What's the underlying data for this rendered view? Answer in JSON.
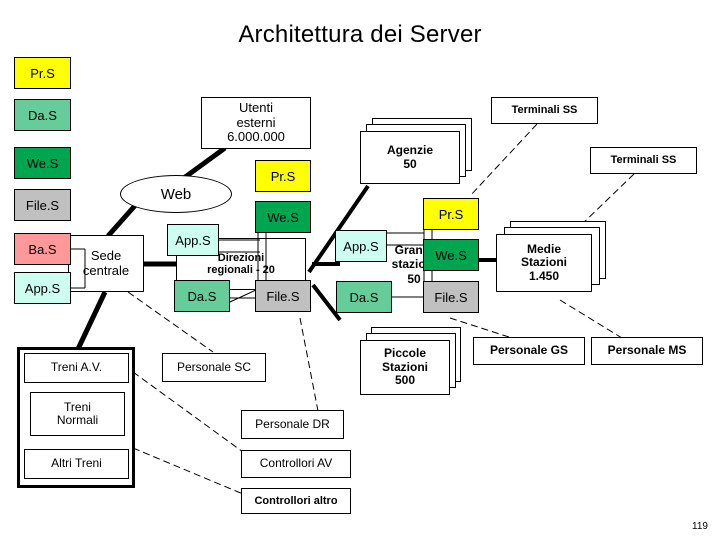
{
  "slide": {
    "title": "Architettura dei Server",
    "page_number": "119",
    "background": "#ffffff"
  },
  "legend": {
    "items": [
      {
        "label": "Pr.S",
        "color": "#ffff00",
        "text_color": "#000000"
      },
      {
        "label": "Da.S",
        "color": "#66cc99",
        "text_color": "#000000"
      },
      {
        "label": "We.S",
        "color": "#00a550",
        "text_color": "#000000"
      },
      {
        "label": "File.S",
        "color": "#c0c0c0",
        "text_color": "#000000"
      },
      {
        "label": "Ba.S",
        "color": "#ff9999",
        "text_color": "#000000"
      },
      {
        "label": "App.S",
        "color": "#ccfff0",
        "text_color": "#000000"
      }
    ]
  },
  "nodes": {
    "utenti_esterni": {
      "line1": "Utenti",
      "line2": "esterni",
      "line3": "6.000.000"
    },
    "web": {
      "label": "Web"
    },
    "sede_centrale": {
      "line1": "Sede",
      "line2": "centrale"
    },
    "agenzie": {
      "line1": "Agenzie",
      "line2": "50"
    },
    "terminali_ss_1": {
      "label": "Terminali SS"
    },
    "terminali_ss_2": {
      "label": "Terminali SS"
    },
    "direzioni_regionali": {
      "line1": "Direzioni",
      "line2": "regionali - 20"
    },
    "grandi_stazioni": {
      "line1": "Grandi",
      "line2": "stazioni",
      "line3": "50"
    },
    "medie_stazioni": {
      "line1": "Medie",
      "line2": "Stazioni",
      "line3": "1.450"
    },
    "piccole_stazioni": {
      "line1": "Piccole",
      "line2": "Stazioni",
      "line3": "500"
    },
    "treni_av": {
      "label": "Treni A.V."
    },
    "treni_normali": {
      "line1": "Treni",
      "line2": "Normali"
    },
    "altri_treni": {
      "label": "Altri Treni"
    },
    "personale_sc": {
      "label": "Personale SC"
    },
    "personale_dr": {
      "label": "Personale DR"
    },
    "controllori_av": {
      "label": "Controllori AV"
    },
    "controllori_altro": {
      "label": "Controllori altro"
    },
    "personale_gs": {
      "label": "Personale GS"
    },
    "personale_ms": {
      "label": "Personale MS"
    }
  },
  "server_clusters": {
    "sede": [
      {
        "label": "Ba.S",
        "color": "#ff9999"
      },
      {
        "label": "App.S",
        "color": "#ccfff0"
      }
    ],
    "direzioni": [
      {
        "label": "Pr.S",
        "color": "#ffff00"
      },
      {
        "label": "We.S",
        "color": "#00a550"
      },
      {
        "label": "App.S",
        "color": "#ccfff0"
      },
      {
        "label": "Da.S",
        "color": "#66cc99"
      },
      {
        "label": "File.S",
        "color": "#c0c0c0"
      }
    ],
    "grandi": [
      {
        "label": "Pr.S",
        "color": "#ffff00"
      },
      {
        "label": "We.S",
        "color": "#00a550"
      },
      {
        "label": "App.S",
        "color": "#ccfff0"
      },
      {
        "label": "Da.S",
        "color": "#66cc99"
      },
      {
        "label": "File.S",
        "color": "#c0c0c0"
      }
    ]
  }
}
